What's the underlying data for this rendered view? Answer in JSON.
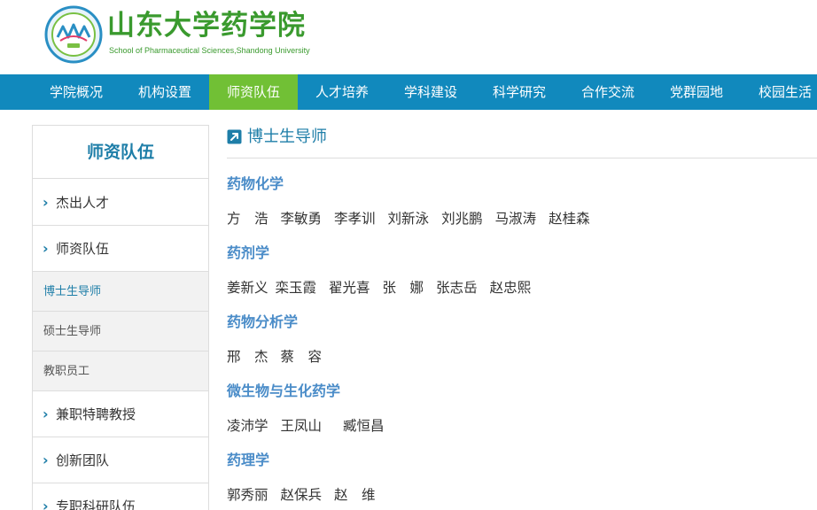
{
  "header": {
    "title": "山东大学药学院",
    "subtitle": "School of Pharmaceutical Sciences,Shandong University",
    "logo_icon": "school-logo"
  },
  "nav": {
    "items": [
      "学院概况",
      "机构设置",
      "师资队伍",
      "人才培养",
      "学科建设",
      "科学研究",
      "合作交流",
      "党群园地",
      "校园生活"
    ],
    "active": "师资队伍",
    "colors": {
      "bar": "#1189bd",
      "active": "#71c035"
    }
  },
  "sidebar": {
    "title": "师资队伍",
    "items": [
      {
        "label": "杰出人才",
        "icon": "chevron-right-icon"
      },
      {
        "label": "师资队伍",
        "icon": "chevron-right-icon"
      }
    ],
    "subitems": [
      "博士生导师",
      "硕士生导师",
      "教职员工"
    ],
    "active_sub": "博士生导师",
    "more_items": [
      {
        "label": "兼职特聘教授",
        "icon": "chevron-right-icon"
      },
      {
        "label": "创新团队",
        "icon": "chevron-right-icon"
      },
      {
        "label": "专职科研队伍",
        "icon": "chevron-right-icon"
      }
    ]
  },
  "main": {
    "title": "博士生导师",
    "title_icon": "external-link-icon",
    "sections": [
      {
        "category": "药物化学",
        "names": [
          "方　浩",
          "李敏勇",
          "李孝训",
          "刘新泳",
          "刘兆鹏",
          "马淑涛",
          "赵桂森"
        ]
      },
      {
        "category": "药剂学",
        "names": [
          "姜新义",
          "栾玉霞",
          "翟光喜",
          "张　娜",
          "张志岳",
          "赵忠熙"
        ]
      },
      {
        "category": "药物分析学",
        "names": [
          "邢　杰",
          "蔡　容"
        ]
      },
      {
        "category": "微生物与生化药学",
        "names": [
          "凌沛学",
          "王凤山",
          "臧恒昌"
        ]
      },
      {
        "category": "药理学",
        "names": [
          "郭秀丽",
          "赵保兵",
          "赵　维"
        ]
      }
    ]
  }
}
